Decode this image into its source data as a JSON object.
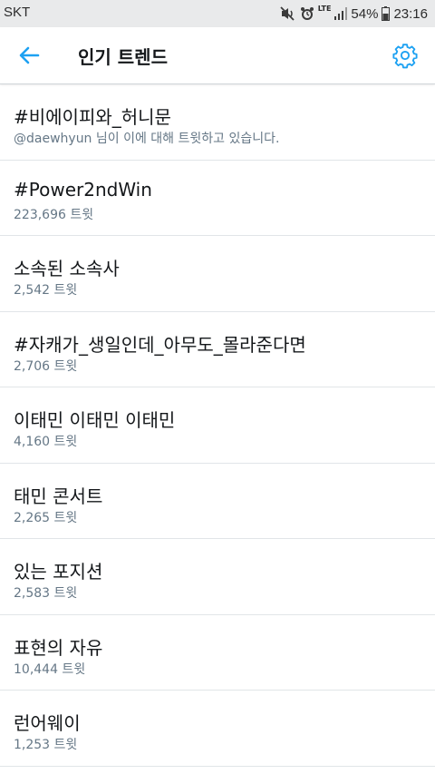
{
  "status_bar": {
    "carrier": "SKT",
    "network": "LTE",
    "battery": "54%",
    "time": "23:16",
    "icons": [
      "mute-icon",
      "alarm-icon",
      "lte-icon",
      "signal-icon",
      "battery-icon"
    ]
  },
  "header": {
    "title": "인기 트렌드",
    "back_icon": "arrow-left-icon",
    "settings_icon": "gear-icon",
    "accent_color": "#1da1f2"
  },
  "trends": [
    {
      "name": "#비에이피와_허니문",
      "meta": "@daewhyun 님이 이에 대해 트윗하고 있습니다."
    },
    {
      "name": "#Power2ndWin",
      "meta": "223,696 트윗"
    },
    {
      "name": "소속된 소속사",
      "meta": "2,542 트윗"
    },
    {
      "name": "#자캐가_생일인데_아무도_몰라준다면",
      "meta": "2,706 트윗"
    },
    {
      "name": "이태민 이태민 이태민",
      "meta": "4,160 트윗"
    },
    {
      "name": "태민 콘서트",
      "meta": "2,265 트윗"
    },
    {
      "name": "있는 포지션",
      "meta": "2,583 트윗"
    },
    {
      "name": "표현의 자유",
      "meta": "10,444 트윗"
    },
    {
      "name": "런어웨이",
      "meta": "1,253 트윗"
    }
  ]
}
